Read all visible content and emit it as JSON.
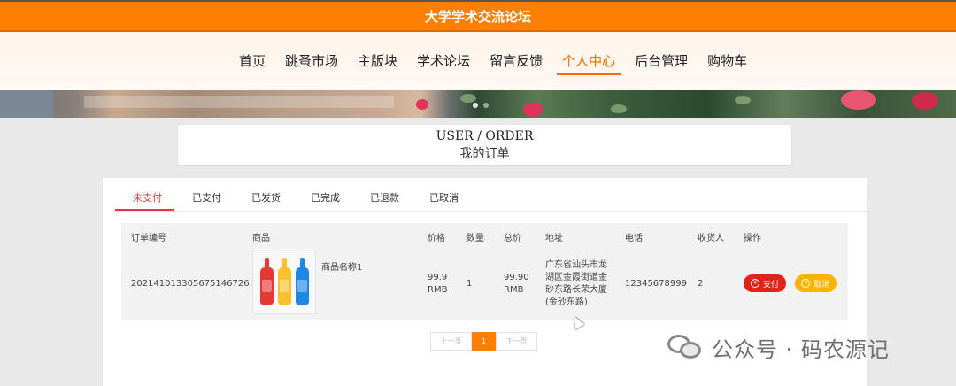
{
  "header": {
    "site_title": "大学学术交流论坛"
  },
  "nav": {
    "items": [
      "首页",
      "跳蚤市场",
      "主版块",
      "学术论坛",
      "留言反馈",
      "个人中心",
      "后台管理",
      "购物车"
    ],
    "active": "个人中心"
  },
  "page_title": {
    "en": "USER / ORDER",
    "cn": "我的订单"
  },
  "tabs": {
    "items": [
      "未支付",
      "已支付",
      "已发货",
      "已完成",
      "已退款",
      "已取消"
    ],
    "active": "未支付"
  },
  "table": {
    "headers": [
      "订单编号",
      "商品",
      "价格",
      "数量",
      "总价",
      "地址",
      "电话",
      "收货人",
      "操作"
    ],
    "rows": [
      {
        "order_no": "20214101330567514672​6",
        "product_name": "商品名称1",
        "price": "99.9",
        "price_unit": "RMB",
        "quantity": "1",
        "total": "99.90",
        "total_unit": "RMB",
        "address": "广东省汕头市龙湖区金霞街道金砂东路长荣大厦(金砂东路)",
        "phone": "12345678999",
        "receiver": "2",
        "pay_label": "支付",
        "cancel_label": "取消"
      }
    ]
  },
  "pagination": {
    "prev": "上一页",
    "current": "1",
    "next": "下一页"
  },
  "watermark": {
    "text": "公众号 · 码农源记"
  },
  "colors": {
    "brand_orange": "#ff7f00",
    "active_red": "#e4393c",
    "pay_red": "#e2231a",
    "cancel_yellow": "#ffb300"
  }
}
